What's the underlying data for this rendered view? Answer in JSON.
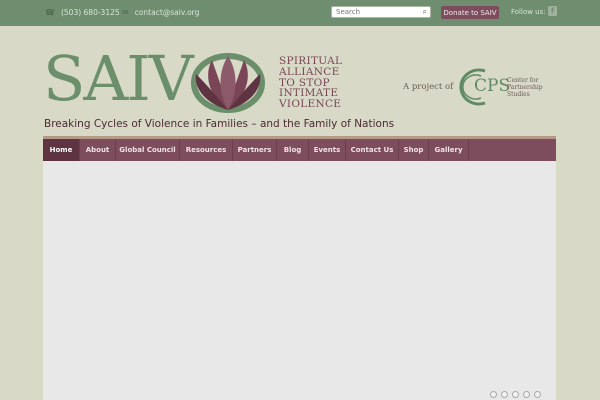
{
  "topbar": {
    "phone": "(503) 680-3125",
    "email": "contact@saiv.org",
    "phone_icon": "phone-icon",
    "email_icon": "mail-icon",
    "search_placeholder": "Search",
    "donate_label": "Donate to SAIV",
    "follow_label": "Follow us:",
    "facebook_glyph": "f"
  },
  "header": {
    "logo_text": "SAIV",
    "logo_words": [
      "SPIRITUAL",
      "ALLIANCE",
      "TO STOP",
      "INTIMATE",
      "VIOLENCE"
    ],
    "project_label": "A project of",
    "partner_logo": "CPS",
    "partner_sub": [
      "Center for",
      "Partnership",
      "Studies"
    ],
    "tagline": "Breaking Cycles of Violence in Families – and the Family of Nations"
  },
  "nav": {
    "items": [
      {
        "label": "Home",
        "active": true
      },
      {
        "label": "About"
      },
      {
        "label": "Global Council"
      },
      {
        "label": "Resources"
      },
      {
        "label": "Partners"
      },
      {
        "label": "Blog"
      },
      {
        "label": "Events"
      },
      {
        "label": "Contact Us"
      },
      {
        "label": "Shop"
      },
      {
        "label": "Gallery"
      }
    ]
  },
  "slider": {
    "dot_count": 5
  },
  "colors": {
    "topbar": "#6f8e6f",
    "nav": "#7d4d5e",
    "background": "#d8d9c7",
    "brand_green": "#6b8f6b"
  }
}
